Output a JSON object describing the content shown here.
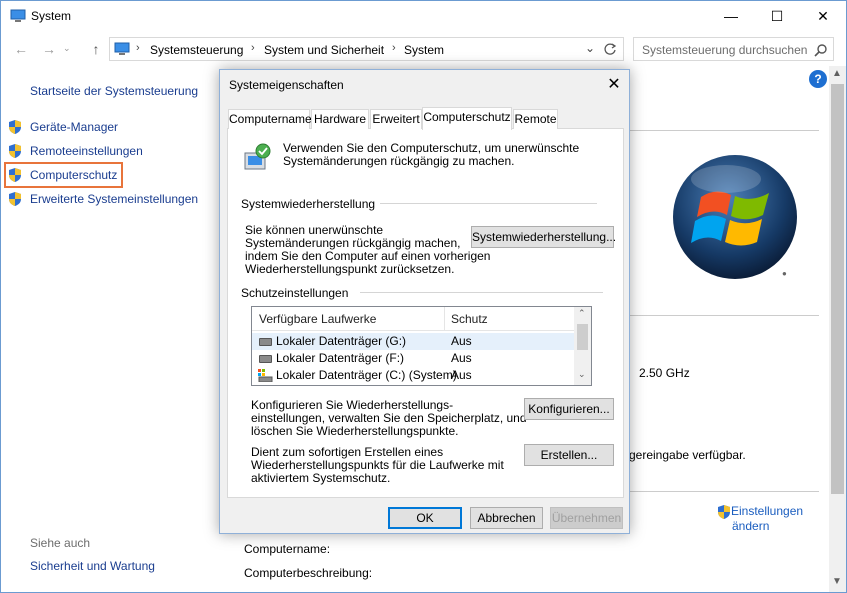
{
  "window": {
    "title": "System",
    "controls": {
      "minimize": "—",
      "maximize": "☐",
      "close": "✕"
    }
  },
  "addressbar": {
    "back": "←",
    "forward": "→",
    "up": "↑",
    "breadcrumbs": [
      "Systemsteuerung",
      "System und Sicherheit",
      "System"
    ],
    "search_placeholder": "Systemsteuerung durchsuchen"
  },
  "leftnav": {
    "home": "Startseite der Systemsteuerung",
    "items": [
      {
        "label": "Geräte-Manager"
      },
      {
        "label": "Remoteeinstellungen"
      },
      {
        "label": "Computerschutz"
      },
      {
        "label": "Erweiterte Systemeinstellungen"
      }
    ],
    "see_also_title": "Siehe auch",
    "see_also_items": [
      "Sicherheit und Wartung"
    ]
  },
  "background": {
    "cpu_speed": "2.50 GHz",
    "pen_text": "gereingabe verfügbar.",
    "change_settings_1": "Einstellungen",
    "change_settings_2": "ändern",
    "computer_name_label": "Computername:",
    "computer_desc_label": "Computerbeschreibung:"
  },
  "dialog": {
    "title": "Systemeigenschaften",
    "close": "✕",
    "tabs": [
      "Computername",
      "Hardware",
      "Erweitert",
      "Computerschutz",
      "Remote"
    ],
    "intro_line1": "Verwenden Sie den Computerschutz, um unerwünschte",
    "intro_line2": "Systemänderungen rückgängig zu machen.",
    "restore_group": "Systemwiederherstellung",
    "restore_text": [
      "Sie können unerwünschte",
      "Systemänderungen rückgängig machen,",
      "indem Sie den Computer auf einen vorherigen",
      "Wiederherstellungspunkt zurücksetzen."
    ],
    "restore_button": "Systemwiederherstellung...",
    "protection_group": "Schutzeinstellungen",
    "list_headers": [
      "Verfügbare Laufwerke",
      "Schutz"
    ],
    "drives": [
      {
        "name": "Lokaler Datenträger (G:)",
        "protection": "Aus"
      },
      {
        "name": "Lokaler Datenträger (F:)",
        "protection": "Aus"
      },
      {
        "name": "Lokaler Datenträger (C:) (System)",
        "protection": "Aus"
      }
    ],
    "configure_text": [
      "Konfigurieren Sie Wiederherstellungs-",
      "einstellungen, verwalten Sie den Speicherplatz, und",
      "löschen Sie Wiederherstellungspunkte."
    ],
    "configure_button": "Konfigurieren...",
    "create_text": [
      "Dient zum sofortigen Erstellen eines",
      "Wiederherstellungspunkts für die Laufwerke mit",
      "aktiviertem Systemschutz."
    ],
    "create_button": "Erstellen...",
    "ok": "OK",
    "cancel": "Abbrechen",
    "apply": "Übernehmen"
  },
  "colors": {
    "link": "#1a3d8f",
    "focus_outline": "#e8743b",
    "accent": "#0078d7",
    "help": "#1e6fd1"
  }
}
